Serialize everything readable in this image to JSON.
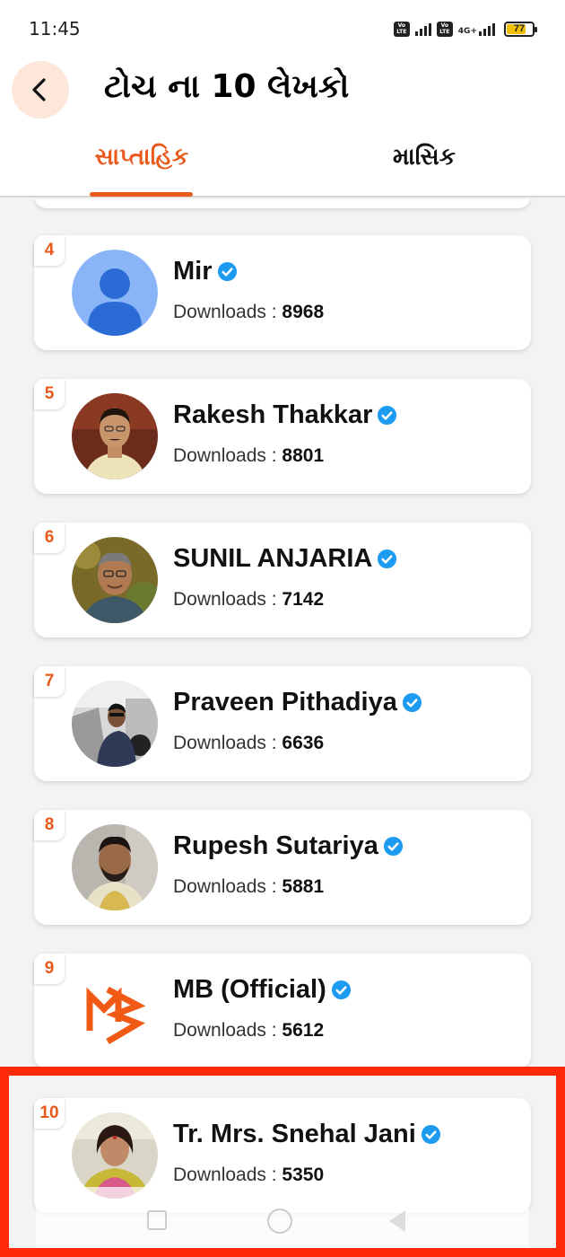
{
  "status_bar": {
    "time": "11:45",
    "volte_label": "Vo\nLTE",
    "network_label": "4G+",
    "battery_level": "77"
  },
  "header": {
    "title": "ટોચ ના 10 લેખકો",
    "back_icon": "chevron-left-icon"
  },
  "tabs": [
    {
      "label": "સાપ્તાહિક",
      "active": true
    },
    {
      "label": "માસિક",
      "active": false
    }
  ],
  "colors": {
    "accent": "#e8591b",
    "verified": "#1d9bf0",
    "highlight": "#ff2a0a"
  },
  "downloads_label": "Downloads : ",
  "authors": [
    {
      "rank": "4",
      "name": "Mir",
      "downloads": "8968",
      "avatar": "default-avatar"
    },
    {
      "rank": "5",
      "name": "Rakesh Thakkar",
      "downloads": "8801",
      "avatar": "photo"
    },
    {
      "rank": "6",
      "name": "SUNIL ANJARIA",
      "downloads": "7142",
      "avatar": "photo"
    },
    {
      "rank": "7",
      "name": "Praveen Pithadiya",
      "downloads": "6636",
      "avatar": "photo"
    },
    {
      "rank": "8",
      "name": "Rupesh Sutariya",
      "downloads": "5881",
      "avatar": "photo"
    },
    {
      "rank": "9",
      "name": "MB (Official)",
      "downloads": "5612",
      "avatar": "mb-logo"
    },
    {
      "rank": "10",
      "name": "Tr. Mrs. Snehal Jani",
      "downloads": "5350",
      "avatar": "photo"
    }
  ]
}
